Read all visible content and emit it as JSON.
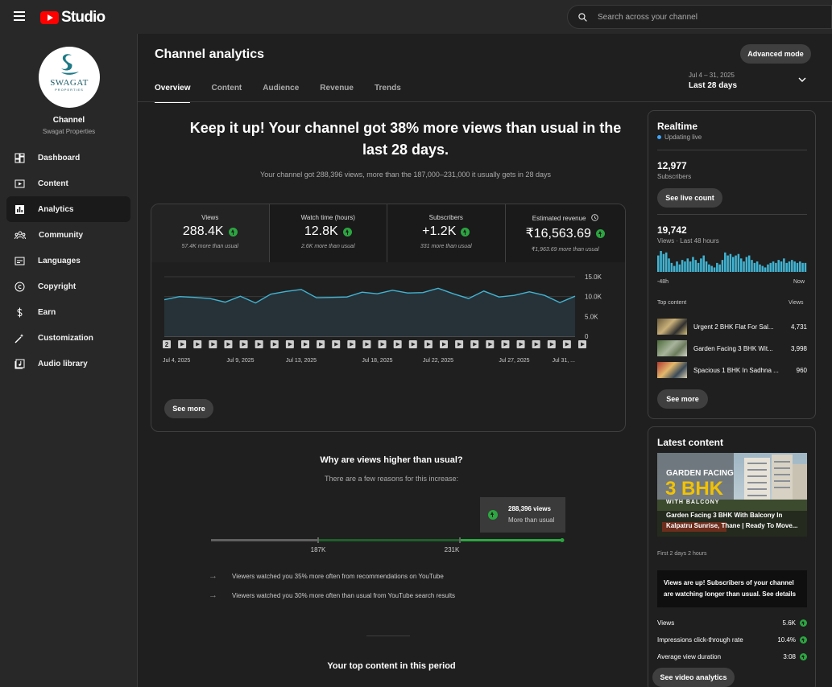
{
  "topbar": {
    "logo_text": "Studio",
    "search_placeholder": "Search across your channel"
  },
  "sidebar": {
    "channel_label": "Channel",
    "channel_name": "Swagat Properties",
    "avatar_logo_text": "SWAGAT",
    "avatar_logo_sub": "PROPERTIES",
    "items": [
      {
        "label": "Dashboard",
        "icon": "dashboard-icon"
      },
      {
        "label": "Content",
        "icon": "content-icon"
      },
      {
        "label": "Analytics",
        "icon": "analytics-icon"
      },
      {
        "label": "Community",
        "icon": "community-icon"
      },
      {
        "label": "Languages",
        "icon": "languages-icon"
      },
      {
        "label": "Copyright",
        "icon": "copyright-icon"
      },
      {
        "label": "Earn",
        "icon": "earn-icon"
      },
      {
        "label": "Customization",
        "icon": "customization-icon"
      },
      {
        "label": "Audio library",
        "icon": "audio-library-icon"
      }
    ]
  },
  "header": {
    "title": "Channel analytics",
    "advanced_mode": "Advanced mode",
    "tabs": [
      "Overview",
      "Content",
      "Audience",
      "Revenue",
      "Trends"
    ],
    "date_range": "Jul 4 – 31, 2025",
    "period": "Last 28 days"
  },
  "summary": {
    "headline": "Keep it up! Your channel got 38% more views than usual in the last 28 days.",
    "subline": "Your channel got 288,396 views, more than the 187,000–231,000 it usually gets in 28 days"
  },
  "metrics": [
    {
      "label": "Views",
      "value": "288.4K",
      "sub": "57.4K more than usual"
    },
    {
      "label": "Watch time (hours)",
      "value": "12.8K",
      "sub": "2.6K more than usual"
    },
    {
      "label": "Subscribers",
      "value": "+1.2K",
      "sub": "331 more than usual"
    },
    {
      "label": "Estimated revenue",
      "value": "₹16,563.69",
      "sub": "₹1,963.69 more than usual"
    }
  ],
  "chart_data": {
    "type": "area",
    "x": [
      "Jul 4, 2025",
      "Jul 5",
      "Jul 6",
      "Jul 7",
      "Jul 8",
      "Jul 9, 2025",
      "Jul 10",
      "Jul 11",
      "Jul 12",
      "Jul 13, 2025",
      "Jul 14",
      "Jul 15",
      "Jul 16",
      "Jul 17",
      "Jul 18, 2025",
      "Jul 19",
      "Jul 20",
      "Jul 21",
      "Jul 22, 2025",
      "Jul 23",
      "Jul 24",
      "Jul 25",
      "Jul 26",
      "Jul 27, 2025",
      "Jul 28",
      "Jul 29",
      "Jul 30",
      "Jul 31, 2025"
    ],
    "xtick_labels": [
      "Jul 4, 2025",
      "Jul 9, 2025",
      "Jul 13, 2025",
      "Jul 18, 2025",
      "Jul 22, 2025",
      "Jul 27, 2025",
      "Jul 31, ..."
    ],
    "xtick_index": [
      0,
      5,
      9,
      14,
      18,
      23,
      27
    ],
    "series": [
      {
        "values": [
          9200,
          10000,
          9800,
          9500,
          8600,
          10100,
          8400,
          10600,
          11300,
          11800,
          9700,
          9800,
          9900,
          11100,
          10700,
          11600,
          10900,
          11000,
          12100,
          10700,
          9500,
          11400,
          9900,
          10300,
          11200,
          10300,
          8500,
          10100
        ]
      }
    ],
    "ylim": [
      0,
      15000
    ],
    "yticks": [
      "0",
      "5.0K",
      "10.0K",
      "15.0K"
    ],
    "grid": true,
    "color": "#41b4d3"
  },
  "chart_markers": {
    "first_label": "2",
    "count": 28
  },
  "see_more": "See more",
  "why": {
    "title": "Why are views higher than usual?",
    "sub": "There are a few reasons for this increase:",
    "tooltip_views": "288,396 views",
    "tooltip_note": "More than usual",
    "range_low": "187K",
    "range_high": "231K",
    "reasons": [
      "Viewers watched you 35% more often from recommendations on YouTube",
      "Viewers watched you 30% more often than usual from YouTube search results"
    ]
  },
  "top_content_title": "Your top content in this period",
  "realtime": {
    "title": "Realtime",
    "status": "Updating live",
    "subscribers": "12,977",
    "subscribers_label": "Subscribers",
    "live_count_btn": "See live count",
    "views": "19,742",
    "views_label": "Views · Last 48 hours",
    "bar_values": [
      22,
      28,
      24,
      26,
      18,
      12,
      8,
      14,
      10,
      16,
      14,
      18,
      14,
      20,
      16,
      12,
      18,
      22,
      14,
      10,
      8,
      6,
      12,
      10,
      16,
      26,
      22,
      24,
      20,
      22,
      24,
      18,
      14,
      20,
      22,
      16,
      12,
      14,
      10,
      8,
      6,
      10,
      12,
      14,
      12,
      16,
      14,
      18,
      12,
      14,
      16,
      14,
      12,
      14,
      12,
      12
    ],
    "axis_left": "-48h",
    "axis_right": "Now",
    "top_content_label": "Top content",
    "views_col": "Views",
    "items": [
      {
        "title": "Urgent 2 BHK Flat For Sal...",
        "views": "4,731"
      },
      {
        "title": "Garden Facing 3 BHK Wit...",
        "views": "3,998"
      },
      {
        "title": "Spacious 1 BHK In Sadhna ...",
        "views": "960"
      }
    ],
    "see_more": "See more"
  },
  "latest": {
    "title": "Latest content",
    "thumb_line1": "GARDEN FACING",
    "thumb_line2": "3 BHK",
    "thumb_line3": "WITH BALCONY",
    "video_title_1": "Garden Facing 3 BHK With Balcony In",
    "video_title_2": "Kalpatru Sunrise, Thane | Ready To Move...",
    "when": "First 2 days 2 hours",
    "message": "Views are up! Subscribers of your channel are watching longer than usual. See details",
    "stats": [
      {
        "label": "Views",
        "value": "5.6K"
      },
      {
        "label": "Impressions click-through rate",
        "value": "10.4%"
      },
      {
        "label": "Average view duration",
        "value": "3:08"
      }
    ],
    "btn": "See video analytics"
  }
}
